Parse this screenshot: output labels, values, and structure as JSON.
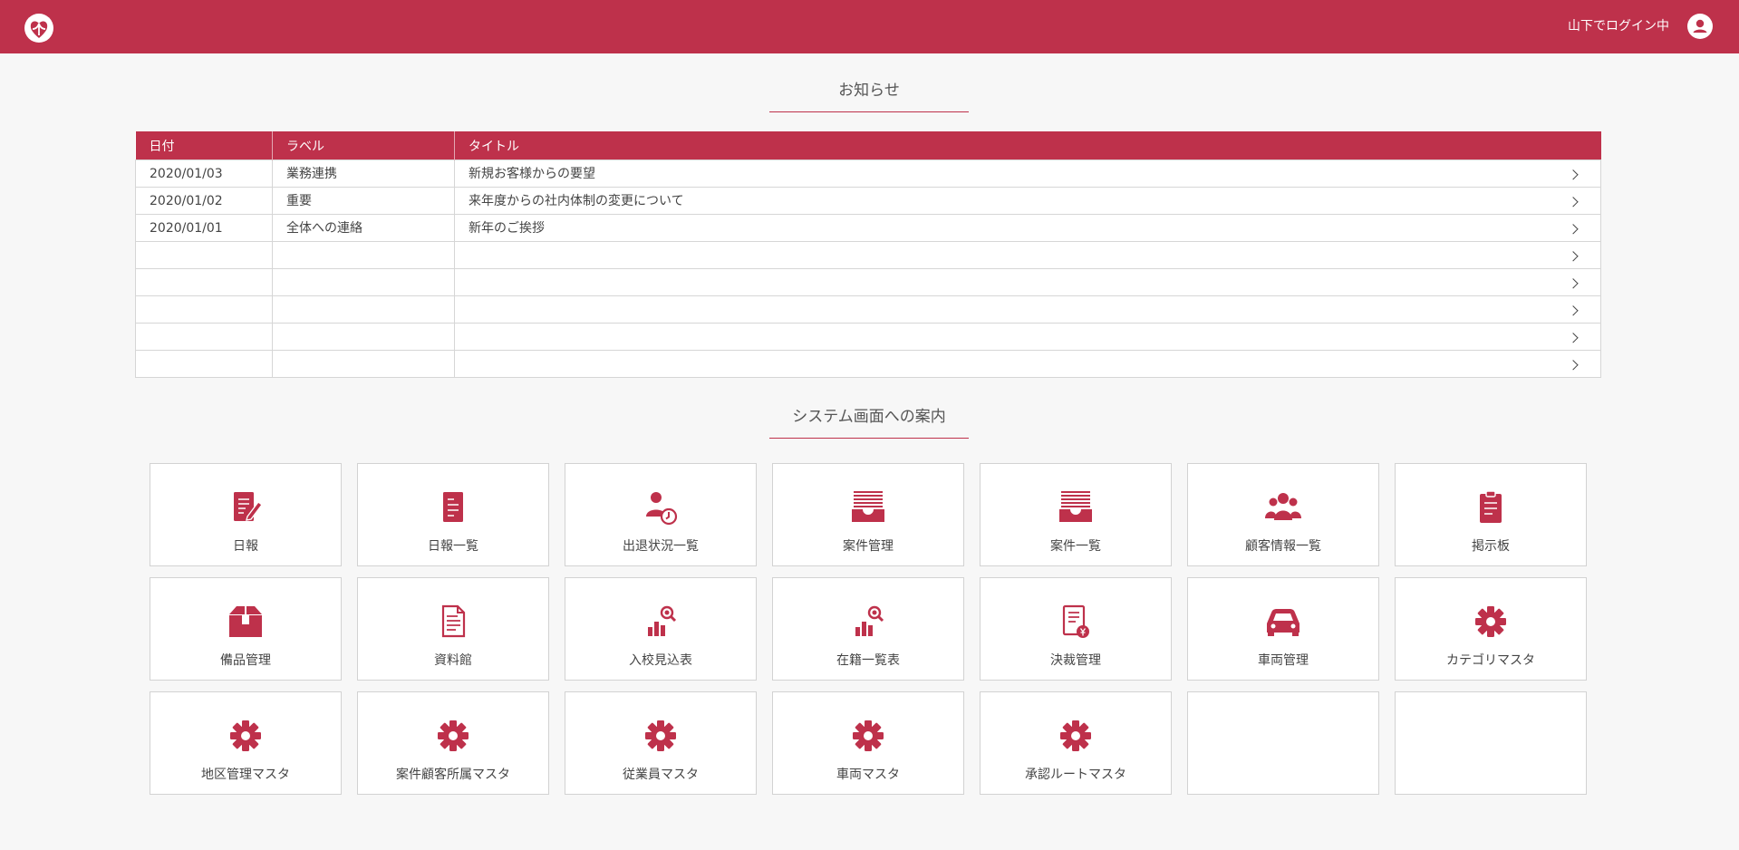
{
  "header": {
    "login_status": "山下でログイン中",
    "logo_icon": "heart-flower-logo-icon",
    "user_icon": "user-avatar-icon",
    "brand_color": "#be314b"
  },
  "news": {
    "title": "お知らせ",
    "columns": [
      "日付",
      "ラベル",
      "タイトル"
    ],
    "rows": [
      {
        "date": "2020/01/03",
        "label": "業務連携",
        "title": "新規お客様からの要望"
      },
      {
        "date": "2020/01/02",
        "label": "重要",
        "title": "来年度からの社内体制の変更について"
      },
      {
        "date": "2020/01/01",
        "label": "全体への連絡",
        "title": "新年のご挨拶"
      },
      {
        "date": "",
        "label": "",
        "title": ""
      },
      {
        "date": "",
        "label": "",
        "title": ""
      },
      {
        "date": "",
        "label": "",
        "title": ""
      },
      {
        "date": "",
        "label": "",
        "title": ""
      },
      {
        "date": "",
        "label": "",
        "title": ""
      }
    ]
  },
  "menu": {
    "title": "システム画面への案内",
    "tiles": [
      {
        "label": "日報",
        "icon": "report-edit-icon"
      },
      {
        "label": "日報一覧",
        "icon": "document-list-icon"
      },
      {
        "label": "出退状況一覧",
        "icon": "person-clock-icon"
      },
      {
        "label": "案件管理",
        "icon": "inbox-tray-icon"
      },
      {
        "label": "案件一覧",
        "icon": "inbox-tray-icon"
      },
      {
        "label": "顧客情報一覧",
        "icon": "people-group-icon"
      },
      {
        "label": "掲示板",
        "icon": "clipboard-icon"
      },
      {
        "label": "備品管理",
        "icon": "box-icon"
      },
      {
        "label": "資料館",
        "icon": "document-icon"
      },
      {
        "label": "入校見込表",
        "icon": "chart-search-icon"
      },
      {
        "label": "在籍一覧表",
        "icon": "chart-search-icon"
      },
      {
        "label": "決裁管理",
        "icon": "invoice-yen-icon"
      },
      {
        "label": "車両管理",
        "icon": "car-icon"
      },
      {
        "label": "カテゴリマスタ",
        "icon": "gear-icon"
      },
      {
        "label": "地区管理マスタ",
        "icon": "gear-icon"
      },
      {
        "label": "案件顧客所属マスタ",
        "icon": "gear-icon"
      },
      {
        "label": "従業員マスタ",
        "icon": "gear-icon"
      },
      {
        "label": "車両マスタ",
        "icon": "gear-icon"
      },
      {
        "label": "承認ルートマスタ",
        "icon": "gear-icon"
      },
      {
        "label": "",
        "icon": ""
      },
      {
        "label": "",
        "icon": ""
      }
    ]
  }
}
